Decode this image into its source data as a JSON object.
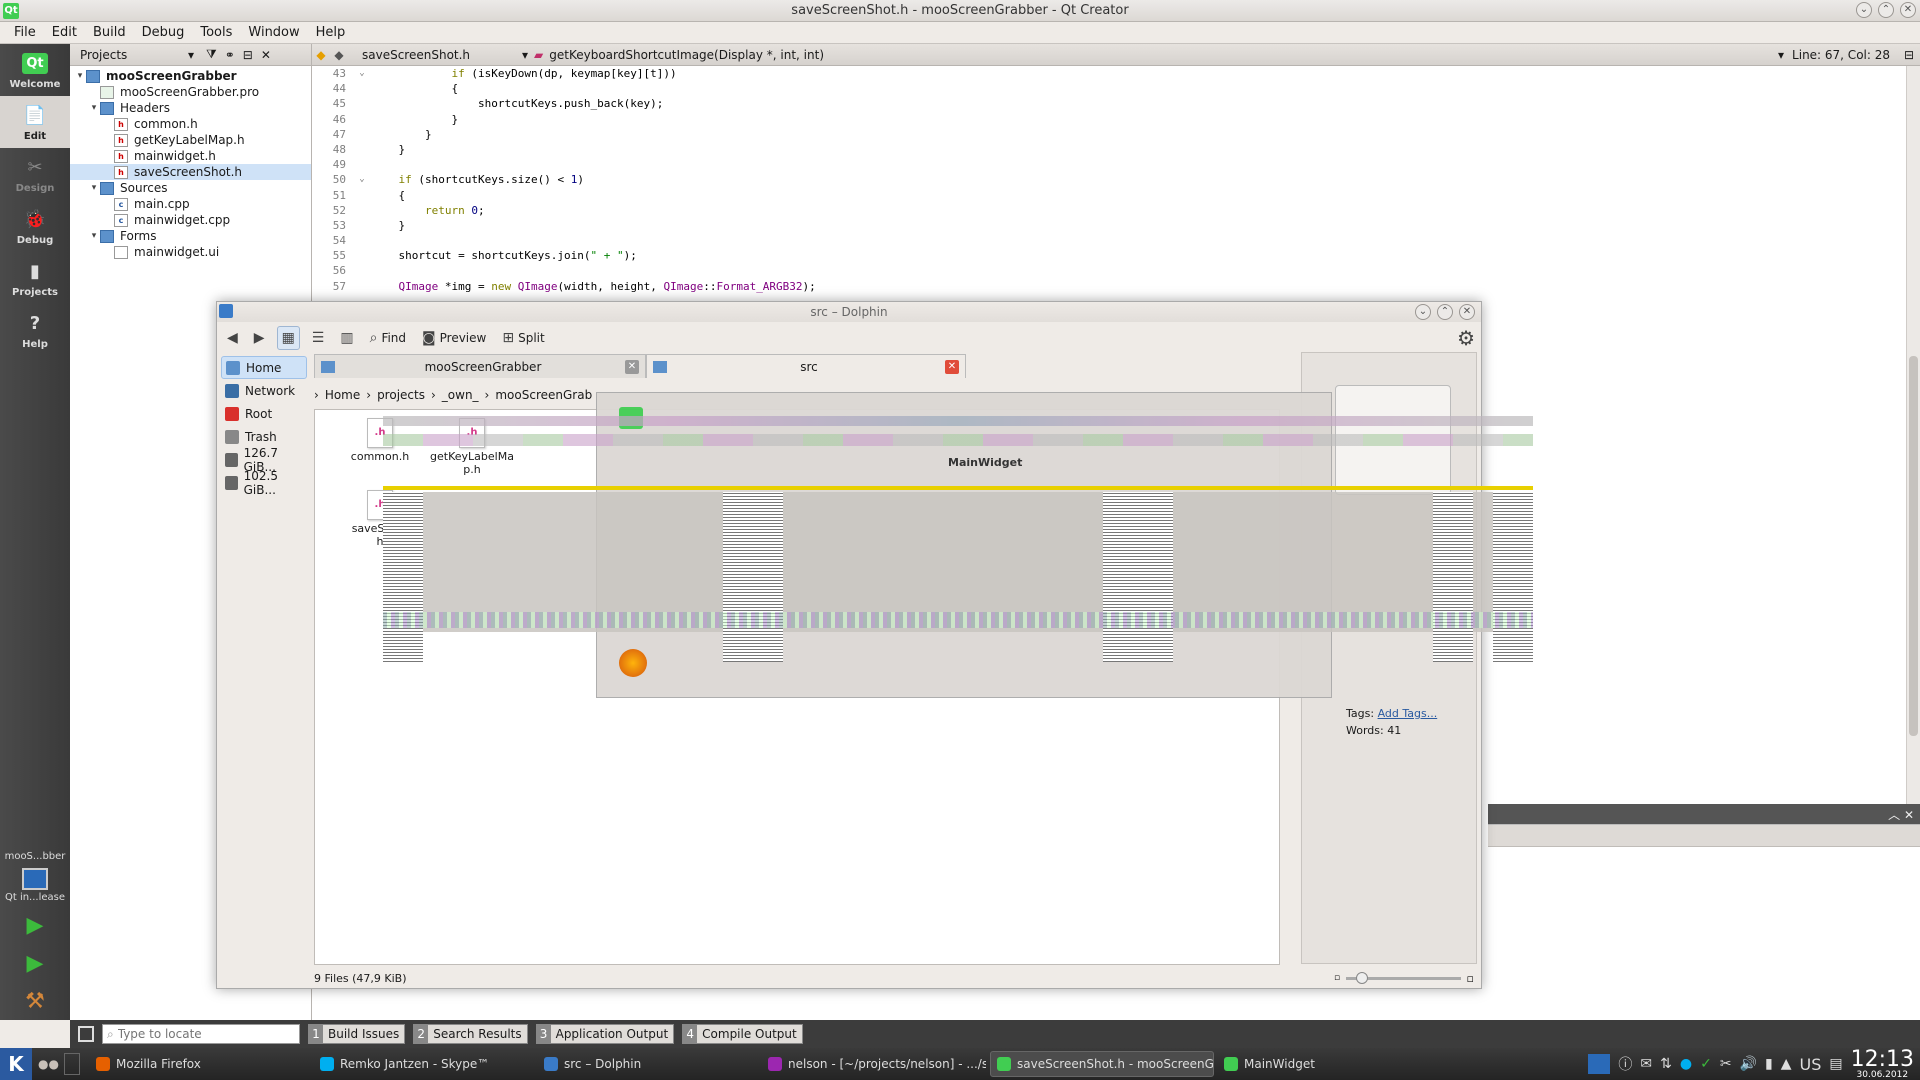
{
  "qtcreator": {
    "title": "saveScreenShot.h - mooScreenGrabber - Qt Creator",
    "menu": [
      "File",
      "Edit",
      "Build",
      "Debug",
      "Tools",
      "Window",
      "Help"
    ],
    "modes": [
      {
        "label": "Welcome",
        "icon": "qt-logo-icon",
        "active": false
      },
      {
        "label": "Edit",
        "icon": "edit-document-icon",
        "active": true
      },
      {
        "label": "Design",
        "icon": "design-tools-icon",
        "active": false
      },
      {
        "label": "Debug",
        "icon": "debug-bug-icon",
        "active": false
      },
      {
        "label": "Projects",
        "icon": "projects-wrench-icon",
        "active": false
      },
      {
        "label": "Help",
        "icon": "help-question-icon",
        "active": false
      }
    ],
    "kit": {
      "project": "mooS...bber",
      "target": "Qt in...lease"
    },
    "projects_panel": {
      "title": "Projects",
      "tree": [
        {
          "label": "mooScreenGrabber",
          "level": 0,
          "type": "project",
          "bold": true
        },
        {
          "label": "mooScreenGrabber.pro",
          "level": 1,
          "type": "pro"
        },
        {
          "label": "Headers",
          "level": 1,
          "type": "folder"
        },
        {
          "label": "common.h",
          "level": 2,
          "type": "h"
        },
        {
          "label": "getKeyLabelMap.h",
          "level": 2,
          "type": "h"
        },
        {
          "label": "mainwidget.h",
          "level": 2,
          "type": "h"
        },
        {
          "label": "saveScreenShot.h",
          "level": 2,
          "type": "h",
          "selected": true
        },
        {
          "label": "Sources",
          "level": 1,
          "type": "folder"
        },
        {
          "label": "main.cpp",
          "level": 2,
          "type": "cpp"
        },
        {
          "label": "mainwidget.cpp",
          "level": 2,
          "type": "cpp"
        },
        {
          "label": "Forms",
          "level": 1,
          "type": "folder"
        },
        {
          "label": "mainwidget.ui",
          "level": 2,
          "type": "ui"
        }
      ]
    },
    "editor": {
      "file": "saveScreenShot.h",
      "function": "getKeyboardShortcutImage(Display *, int, int)",
      "position": "Line: 67, Col: 28",
      "lines": [
        {
          "n": "43",
          "fold": "v",
          "html": "            <span class='kw'>if</span> (isKeyDown(dp, keymap[key][t]))"
        },
        {
          "n": "44",
          "fold": "",
          "html": "            {"
        },
        {
          "n": "45",
          "fold": "",
          "html": "                shortcutKeys.push_back(key);"
        },
        {
          "n": "46",
          "fold": "",
          "html": "            }"
        },
        {
          "n": "47",
          "fold": "",
          "html": "        }"
        },
        {
          "n": "48",
          "fold": "",
          "html": "    }"
        },
        {
          "n": "49",
          "fold": "",
          "html": ""
        },
        {
          "n": "50",
          "fold": "v",
          "html": "    <span class='kw'>if</span> (shortcutKeys.size() &lt; <span class='num'>1</span>)"
        },
        {
          "n": "51",
          "fold": "",
          "html": "    {"
        },
        {
          "n": "52",
          "fold": "",
          "html": "        <span class='kw'>return</span> <span class='num'>0</span>;"
        },
        {
          "n": "53",
          "fold": "",
          "html": "    }"
        },
        {
          "n": "54",
          "fold": "",
          "html": ""
        },
        {
          "n": "55",
          "fold": "",
          "html": "    shortcut = shortcutKeys.join(<span class='str'>\" + \"</span>);"
        },
        {
          "n": "56",
          "fold": "",
          "html": ""
        },
        {
          "n": "57",
          "fold": "",
          "html": "    <span class='ty'>QImage</span> *img = <span class='kw'>new</span> <span class='ty'>QImage</span>(width, height, <span class='ty'>QImage</span>::<span class='ty'>Format_ARGB32</span>);"
        }
      ]
    },
    "locator_placeholder": "Type to locate",
    "output_tabs": [
      {
        "n": "1",
        "label": "Build Issues"
      },
      {
        "n": "2",
        "label": "Search Results"
      },
      {
        "n": "3",
        "label": "Application Output"
      },
      {
        "n": "4",
        "label": "Compile Output"
      }
    ]
  },
  "dolphin": {
    "title": "src – Dolphin",
    "toolbar": {
      "find": "Find",
      "preview": "Preview",
      "split": "Split"
    },
    "places": [
      {
        "label": "Home",
        "active": true,
        "color": "#5c91cb"
      },
      {
        "label": "Network",
        "active": false,
        "color": "#3a6ea5"
      },
      {
        "label": "Root",
        "active": false,
        "color": "#d9302c"
      },
      {
        "label": "Trash",
        "active": false,
        "color": "#888888"
      },
      {
        "label": "126.7 GiB...",
        "active": false,
        "color": "#666666"
      },
      {
        "label": "102.5 GiB...",
        "active": false,
        "color": "#666666"
      }
    ],
    "tabs": [
      {
        "label": "mooScreenGrabber",
        "current": false
      },
      {
        "label": "src",
        "current": true
      }
    ],
    "breadcrumb": [
      "Home",
      "projects",
      "_own_",
      "mooScreenGrab"
    ],
    "files": [
      {
        "name": "common.h"
      },
      {
        "name": "getKeyLabelMa\np.h"
      },
      {
        "name": "saveScree\nh"
      }
    ],
    "info_panel": {
      "tags_label": "Tags:",
      "tags_link": "Add Tags...",
      "words_label": "Words:",
      "words_value": "41"
    },
    "status": "9 Files (47,9 KiB)"
  },
  "ghost_window": {
    "title": "MainWidget"
  },
  "taskbar": {
    "kmenu": "K",
    "tasks": [
      {
        "label": "Mozilla Firefox",
        "color": "#e66000"
      },
      {
        "label": "Remko Jantzen - Skype™",
        "color": "#00aff0"
      },
      {
        "label": "src – Dolphin",
        "color": "#3a7bc8"
      },
      {
        "label": "nelson - [~/projects/nelson] - .../s",
        "color": "#9c27b0"
      },
      {
        "label": "saveScreenShot.h - mooScreenGr",
        "color": "#41cd52",
        "active": true
      },
      {
        "label": "MainWidget",
        "color": "#41cd52"
      }
    ],
    "keyboard_layout": "US",
    "clock_time": "12:13",
    "clock_date": "30.06.2012"
  }
}
